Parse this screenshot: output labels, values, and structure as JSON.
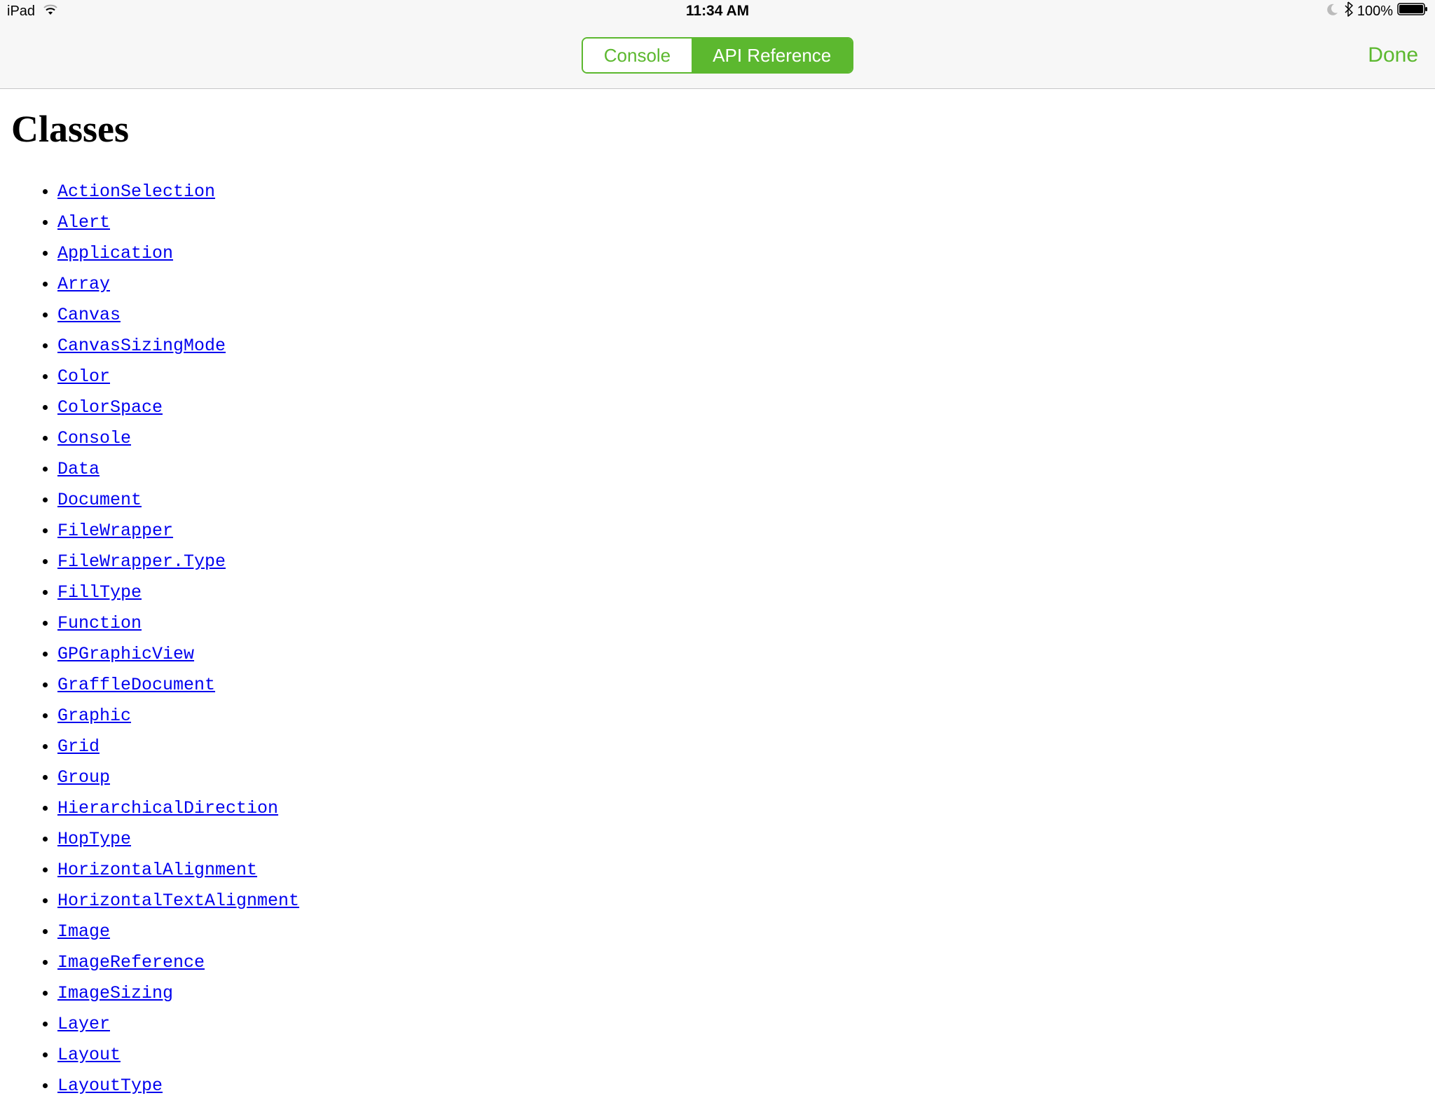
{
  "statusBar": {
    "device": "iPad",
    "time": "11:34 AM",
    "batteryPercent": "100%"
  },
  "navBar": {
    "segments": [
      "Console",
      "API Reference"
    ],
    "activeSegmentIndex": 1,
    "doneLabel": "Done"
  },
  "page": {
    "title": "Classes",
    "classLinks": [
      "ActionSelection",
      "Alert",
      "Application",
      "Array",
      "Canvas",
      "CanvasSizingMode",
      "Color",
      "ColorSpace",
      "Console",
      "Data",
      "Document",
      "FileWrapper",
      "FileWrapper.Type",
      "FillType",
      "Function",
      "GPGraphicView",
      "GraffleDocument",
      "Graphic",
      "Grid",
      "Group",
      "HierarchicalDirection",
      "HopType",
      "HorizontalAlignment",
      "HorizontalTextAlignment",
      "Image",
      "ImageReference",
      "ImageSizing",
      "Layer",
      "Layout",
      "LayoutType"
    ]
  }
}
